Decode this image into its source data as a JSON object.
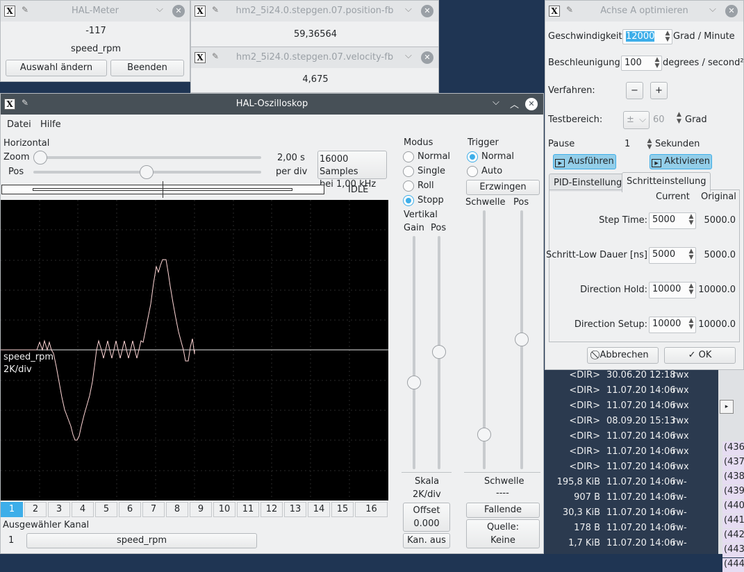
{
  "meter": {
    "title": "HAL-Meter",
    "value": "-117",
    "signal": "speed_rpm",
    "select_label": "Auswahl ändern",
    "quit_label": "Beenden"
  },
  "pos_win": {
    "title": "hm2_5i24.0.stepgen.07.position-fb",
    "value": "59,36564"
  },
  "vel_win": {
    "title": "hm2_5i24.0.stepgen.07.velocity-fb",
    "value": "4,675"
  },
  "scope": {
    "title": "HAL-Oszilloskop",
    "menu": [
      "Datei",
      "Hilfe"
    ],
    "horizontal": "Horizontal",
    "zoom": "Zoom",
    "pos": "Pos",
    "time_div": "2,00 s",
    "per_div": "per div",
    "samples": "16000 Samples",
    "rate": "bei 1,00 kHz",
    "status": "IDLE",
    "mode_title": "Modus",
    "modes": [
      "Normal",
      "Single",
      "Roll",
      "Stopp"
    ],
    "trigger_title": "Trigger",
    "triggers": [
      "Normal",
      "Auto"
    ],
    "force": "Erzwingen",
    "vertical": "Vertikal",
    "gain": "Gain",
    "vpos": "Pos",
    "schwelle": "Schwelle",
    "tpos": "Pos",
    "channel_label": "speed_rpm",
    "channel_div": "2K/div",
    "scale_title": "Skala",
    "scale_value": "2K/div",
    "offset": "Offset",
    "offset_value": "0.000",
    "ch_off": "Kan. aus",
    "level_title": "Schwelle",
    "level_value": "----",
    "falling": "Fallende",
    "source": "Quelle:",
    "source_value": "Keine",
    "channels": [
      "1",
      "2",
      "3",
      "4",
      "5",
      "6",
      "7",
      "8",
      "9",
      "10",
      "11",
      "12",
      "13",
      "14",
      "15",
      "16"
    ],
    "selected_title": "Ausgewähler Kanal",
    "selected_num": "1",
    "selected_signal": "speed_rpm"
  },
  "tune": {
    "title": "Achse A optimieren",
    "speed_label": "Geschwindigkeit:",
    "speed_value": "12000",
    "speed_unit": "Grad / Minute",
    "accel_label": "Beschleunigung:",
    "accel_value": "100",
    "accel_unit": "degrees / second²",
    "jog_label": "Verfahren:",
    "jog_minus": "−",
    "jog_plus": "+",
    "range_label": "Testbereich:",
    "range_sign": "±",
    "range_value": "60",
    "range_unit": "Grad",
    "pause_label": "Pause",
    "pause_value": "1",
    "pause_unit": "Sekunden",
    "run": "Ausführen",
    "enable": "Aktivieren",
    "tabs": [
      "PID-Einstellung",
      "Schritteinstellung"
    ],
    "col_current": "Current",
    "col_original": "Original",
    "rows": [
      {
        "label": "Step Time:",
        "current": "5000",
        "original": "5000.0"
      },
      {
        "label": "Schritt-Low Dauer [ns]",
        "current": "5000",
        "original": "5000.0"
      },
      {
        "label": "Direction Hold:",
        "current": "10000",
        "original": "10000.0"
      },
      {
        "label": "Direction Setup:",
        "current": "10000",
        "original": "10000.0"
      }
    ],
    "cancel": "Abbrechen",
    "ok": "OK"
  },
  "files": [
    {
      "size": "<DIR>",
      "date": "30.06.20 12:18",
      "perm": "rwx"
    },
    {
      "size": "<DIR>",
      "date": "11.07.20 14:06",
      "perm": "rwx"
    },
    {
      "size": "<DIR>",
      "date": "11.07.20 14:06",
      "perm": "rwx"
    },
    {
      "size": "<DIR>",
      "date": "08.09.20 15:13",
      "perm": "rwx"
    },
    {
      "size": "<DIR>",
      "date": "11.07.20 14:06",
      "perm": "rwx"
    },
    {
      "size": "<DIR>",
      "date": "11.07.20 14:06",
      "perm": "rwx"
    },
    {
      "size": "<DIR>",
      "date": "11.07.20 14:06",
      "perm": "rwx"
    },
    {
      "size": "195,8 KiB",
      "date": "11.07.20 14:06",
      "perm": "rw-"
    },
    {
      "size": "907 B",
      "date": "11.07.20 14:06",
      "perm": "rw-"
    },
    {
      "size": "30,3 KiB",
      "date": "11.07.20 14:06",
      "perm": "rw-"
    },
    {
      "size": "178 B",
      "date": "11.07.20 14:06",
      "perm": "rw-"
    },
    {
      "size": "1,7 KiB",
      "date": "11.07.20 14:06",
      "perm": "rw-"
    }
  ],
  "side_numbers": [
    "(436",
    "(437",
    "(438",
    "(439",
    "(440",
    "(441",
    "(442",
    "(443",
    "(444"
  ],
  "colors": {
    "accent": "#3daee9",
    "titlebar_active": "#475057",
    "scope_bg": "#000000",
    "trace": "#ffd6d6"
  }
}
